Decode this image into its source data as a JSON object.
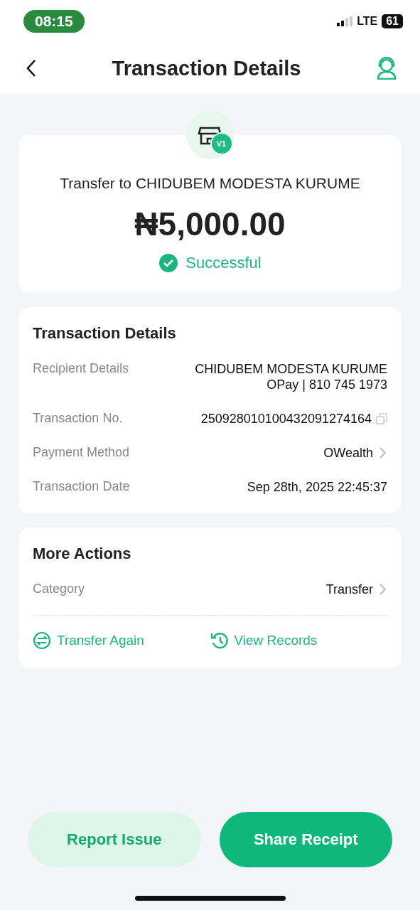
{
  "status_bar": {
    "time": "08:15",
    "network": "LTE",
    "battery": "61"
  },
  "header": {
    "title": "Transaction Details"
  },
  "summary": {
    "badge": "V1",
    "title": "Transfer to CHIDUBEM MODESTA KURUME",
    "amount": "₦5,000.00",
    "status": "Successful"
  },
  "details": {
    "title": "Transaction Details",
    "rows": [
      {
        "kind": "multi",
        "label": "Recipient Details",
        "lines": [
          "CHIDUBEM MODESTA KURUME",
          "OPay | 810 745 1973"
        ]
      },
      {
        "kind": "copy",
        "label": "Transaction No.",
        "value": "250928010100432091274164"
      },
      {
        "kind": "link",
        "label": "Payment Method",
        "value": "OWealth"
      },
      {
        "kind": "plain",
        "label": "Transaction Date",
        "value": "Sep 28th, 2025 22:45:37"
      }
    ]
  },
  "more_actions": {
    "title": "More Actions",
    "category": {
      "label": "Category",
      "value": "Transfer"
    },
    "actions": [
      {
        "kind": "transfer",
        "label": "Transfer Again"
      },
      {
        "kind": "history",
        "label": "View Records"
      }
    ]
  },
  "buttons": [
    {
      "kind": "secondary",
      "label": "Report Issue"
    },
    {
      "kind": "primary",
      "label": "Share Receipt"
    }
  ]
}
